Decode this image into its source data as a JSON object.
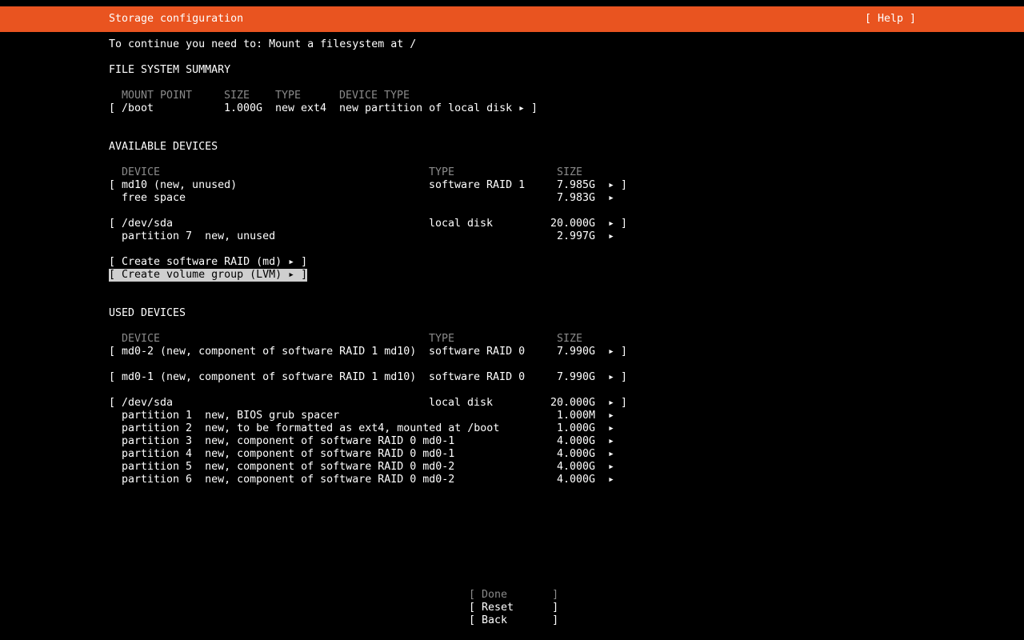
{
  "header": {
    "title": "Storage configuration",
    "help": "[ Help ]",
    "color": "#e95420"
  },
  "instruction": "To continue you need to: Mount a filesystem at /",
  "fs_summary": {
    "heading": "FILE SYSTEM SUMMARY",
    "columns": {
      "mount": "MOUNT POINT",
      "size": "SIZE",
      "type": "TYPE",
      "device_type": "DEVICE TYPE"
    },
    "rows": [
      {
        "open": "[",
        "mount": "/boot",
        "size": "1.000G",
        "type": "new ext4",
        "device_type": "new partition of local disk",
        "arrow": "▸",
        "close": "]"
      }
    ]
  },
  "available": {
    "heading": "AVAILABLE DEVICES",
    "columns": {
      "device": "DEVICE",
      "type": "TYPE",
      "size": "SIZE"
    },
    "md10": {
      "open": "[",
      "device": "md10 (new, unused)",
      "type": "software RAID 1",
      "size": "7.985G",
      "arrow": "▸",
      "close": "]"
    },
    "md10_free": {
      "device": "free space",
      "size": "7.983G",
      "arrow": "▸"
    },
    "sda": {
      "open": "[",
      "device": "/dev/sda",
      "type": "local disk",
      "size": "20.000G",
      "arrow": "▸",
      "close": "]"
    },
    "sda_p7": {
      "device": "partition 7  new, unused",
      "size": "2.997G",
      "arrow": "▸"
    },
    "create_raid": "[ Create software RAID (md) ▸ ]",
    "create_lvm": "[ Create volume group (LVM) ▸ ]"
  },
  "used": {
    "heading": "USED DEVICES",
    "columns": {
      "device": "DEVICE",
      "type": "TYPE",
      "size": "SIZE"
    },
    "md0_2": {
      "open": "[",
      "device": "md0-2 (new, component of software RAID 1 md10)",
      "type": "software RAID 0",
      "size": "7.990G",
      "arrow": "▸",
      "close": "]"
    },
    "md0_1": {
      "open": "[",
      "device": "md0-1 (new, component of software RAID 1 md10)",
      "type": "software RAID 0",
      "size": "7.990G",
      "arrow": "▸",
      "close": "]"
    },
    "sda": {
      "open": "[",
      "device": "/dev/sda",
      "type": "local disk",
      "size": "20.000G",
      "arrow": "▸",
      "close": "]"
    },
    "partitions": [
      {
        "device": "partition 1  new, BIOS grub spacer",
        "size": "1.000M",
        "arrow": "▸"
      },
      {
        "device": "partition 2  new, to be formatted as ext4, mounted at /boot",
        "size": "1.000G",
        "arrow": "▸"
      },
      {
        "device": "partition 3  new, component of software RAID 0 md0-1",
        "size": "4.000G",
        "arrow": "▸"
      },
      {
        "device": "partition 4  new, component of software RAID 0 md0-1",
        "size": "4.000G",
        "arrow": "▸"
      },
      {
        "device": "partition 5  new, component of software RAID 0 md0-2",
        "size": "4.000G",
        "arrow": "▸"
      },
      {
        "device": "partition 6  new, component of software RAID 0 md0-2",
        "size": "4.000G",
        "arrow": "▸"
      }
    ]
  },
  "buttons": {
    "done": "[ Done       ]",
    "reset": "[ Reset      ]",
    "back": "[ Back       ]"
  }
}
